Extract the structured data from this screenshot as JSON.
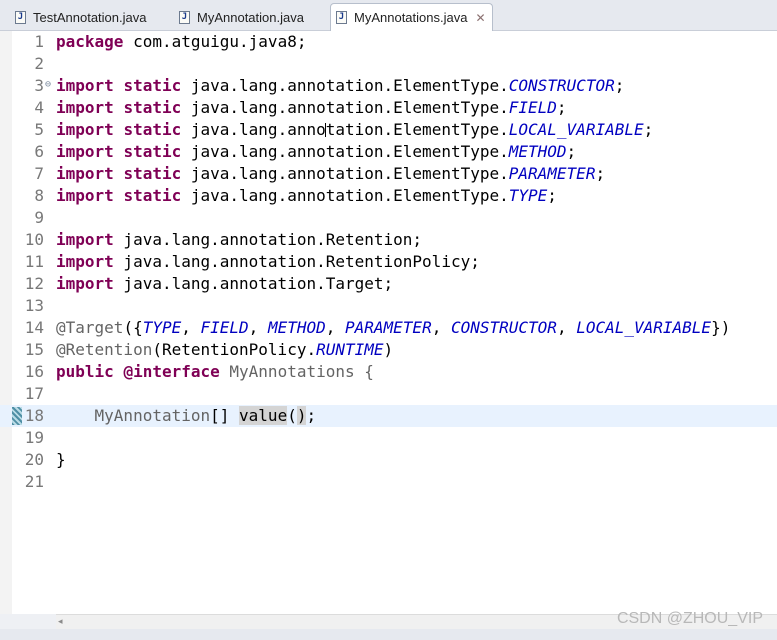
{
  "tabs": [
    {
      "label": "TestAnnotation.java",
      "active": false
    },
    {
      "label": "MyAnnotation.java",
      "active": false
    },
    {
      "label": "MyAnnotations.java",
      "active": true
    }
  ],
  "tab_close_glyph": "✕",
  "java_icon_glyph": "J",
  "fold_glyph": "⊖",
  "editor": {
    "current_line": 18,
    "line_numbers": [
      "1",
      "2",
      "3",
      "4",
      "5",
      "6",
      "7",
      "8",
      "9",
      "10",
      "11",
      "12",
      "13",
      "14",
      "15",
      "16",
      "17",
      "18",
      "19",
      "20",
      "21"
    ]
  },
  "code": {
    "l1": {
      "kw": "package",
      "rest": " com.atguigu.java8;"
    },
    "l3": {
      "kw1": "import",
      "kw2": "static",
      "pkg": " java.lang.annotation.ElementType.",
      "const": "CONSTRUCTOR",
      "end": ";"
    },
    "l4": {
      "kw1": "import",
      "kw2": "static",
      "pkg": " java.lang.annotation.ElementType.",
      "const": "FIELD",
      "end": ";"
    },
    "l5": {
      "kw1": "import",
      "kw2": "static",
      "pkg": " java.lang.annotation.ElementType.",
      "const": "LOCAL_VARIABLE",
      "end": ";"
    },
    "l6": {
      "kw1": "import",
      "kw2": "static",
      "pkg": " java.lang.annotation.ElementType.",
      "const": "METHOD",
      "end": ";"
    },
    "l7": {
      "kw1": "import",
      "kw2": "static",
      "pkg": " java.lang.annotation.ElementType.",
      "const": "PARAMETER",
      "end": ";"
    },
    "l8": {
      "kw1": "import",
      "kw2": "static",
      "pkg": " java.lang.annotation.ElementType.",
      "const": "TYPE",
      "end": ";"
    },
    "l10": {
      "kw": "import",
      "rest": " java.lang.annotation.Retention;"
    },
    "l11": {
      "kw": "import",
      "rest": " java.lang.annotation.RetentionPolicy;"
    },
    "l12": {
      "kw": "import",
      "rest": " java.lang.annotation.Target;"
    },
    "l14": {
      "ann": "@Target",
      "p1": "({",
      "c1": "TYPE",
      "s1": ", ",
      "c2": "FIELD",
      "s2": ", ",
      "c3": "METHOD",
      "s3": ", ",
      "c4": "PARAMETER",
      "s4": ", ",
      "c5": "CONSTRUCTOR",
      "s5": ", ",
      "c6": "LOCAL_VARIABLE",
      "p2": "})"
    },
    "l15": {
      "ann": "@Retention",
      "p1": "(RetentionPolicy.",
      "c1": "RUNTIME",
      "p2": ")"
    },
    "l16": {
      "kw1": "public",
      "kw2": "@interface",
      "name": " MyAnnotations {"
    },
    "l18": {
      "indent": "    ",
      "type": "MyAnnotation",
      "mid": "[] ",
      "method": "value",
      "paren_open": "(",
      "paren_close": ")",
      "end": ";"
    },
    "l20": {
      "text": "}"
    }
  },
  "watermark": "CSDN @ZHOU_VIP",
  "scroll_arrow": "◂",
  "colors": {
    "keyword": "#7f0055",
    "static_const": "#0000c0",
    "annotation": "#646464",
    "current_line_bg": "#e8f2fe"
  }
}
